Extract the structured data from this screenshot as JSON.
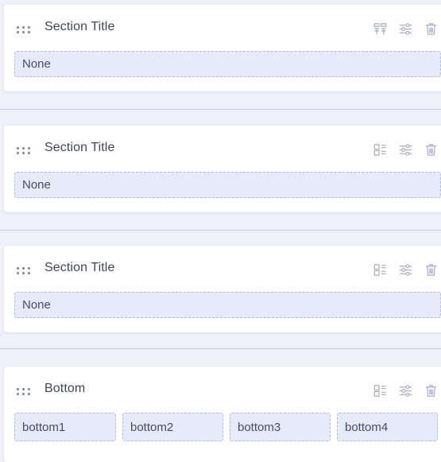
{
  "sections": [
    {
      "title": "Section Title",
      "slots": [
        "None"
      ]
    },
    {
      "title": "Section Title",
      "slots": [
        "None"
      ]
    },
    {
      "title": "Section Title",
      "slots": [
        "None"
      ]
    },
    {
      "title": "Bottom",
      "slots": [
        "bottom1",
        "bottom2",
        "bottom3",
        "bottom4"
      ]
    }
  ],
  "icons": {
    "drag": "drag-handle-icon",
    "layout": "layout-icon",
    "settings": "sliders-icon",
    "delete": "trash-icon"
  },
  "colors": {
    "background": "#eef1f7",
    "card": "#ffffff",
    "slot_fill": "#e6eafb",
    "slot_border": "#b2badb",
    "icon": "#a9aec4",
    "title_text": "#3f4463"
  }
}
